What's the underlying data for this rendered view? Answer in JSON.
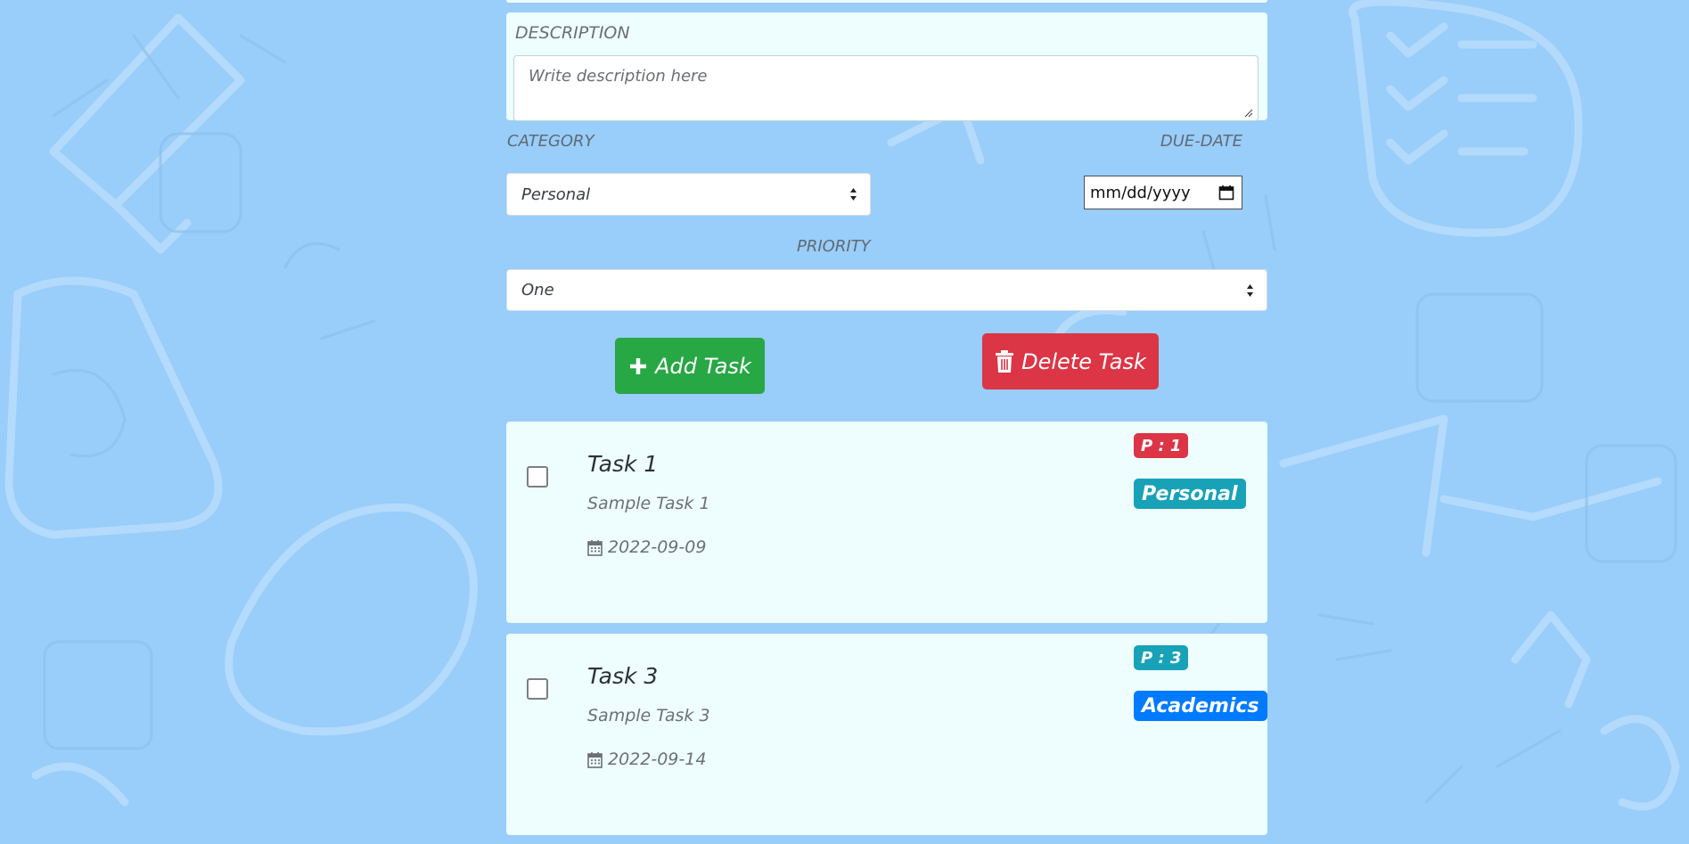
{
  "colors": {
    "background": "#99cdfa",
    "panel": "#eefdfd",
    "success": "#28a745",
    "danger": "#dc3545",
    "info": "#17a2b8",
    "primary": "#007bff"
  },
  "form": {
    "description_label": "DESCRIPTION",
    "description_placeholder": "Write description here",
    "category_label": "CATEGORY",
    "category_value": "Personal",
    "duedate_label": "DUE-DATE",
    "duedate_value": "mm/dd/yyyy",
    "priority_label": "PRIORITY",
    "priority_value": "One"
  },
  "buttons": {
    "add_icon": "plus-icon",
    "add_label": "Add Task",
    "delete_icon": "trash-icon",
    "delete_label": "Delete Task"
  },
  "tasks": [
    {
      "title": "Task 1",
      "description": "Sample Task 1",
      "date": "2022-09-09",
      "priority": "P : 1",
      "priority_color": "#dc3545",
      "category": "Personal",
      "category_color": "#17a2b8",
      "checked": false
    },
    {
      "title": "Task 3",
      "description": "Sample Task 3",
      "date": "2022-09-14",
      "priority": "P : 3",
      "priority_color": "#17a2b8",
      "category": "Academics",
      "category_color": "#007bff",
      "checked": false
    }
  ]
}
